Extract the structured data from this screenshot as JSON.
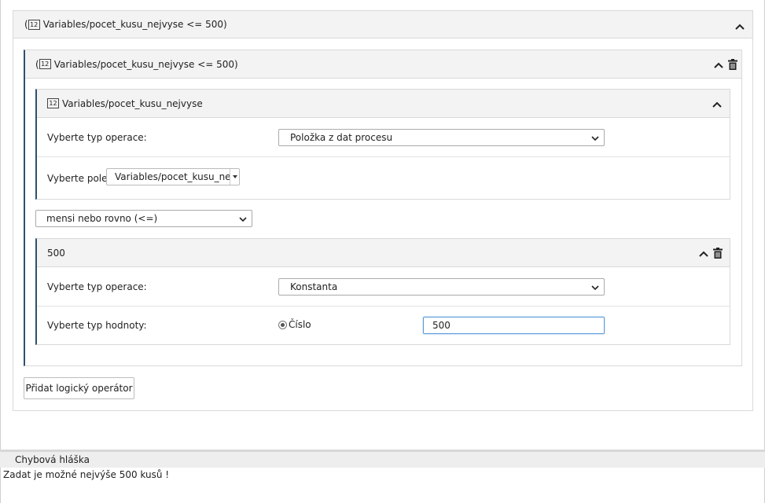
{
  "condition_outer": {
    "title": "Variables/pocet_kusu_nejvyse <= 500)",
    "prefix": "(",
    "icon": "number-12-icon",
    "icon_text": "12"
  },
  "condition_group": {
    "title": "Variables/pocet_kusu_nejvyse <= 500)",
    "prefix": "(",
    "icon": "number-12-icon",
    "icon_text": "12"
  },
  "left_operand": {
    "title": "Variables/pocet_kusu_nejvyse",
    "icon": "number-12-icon",
    "icon_text": "12",
    "operation_label": "Vyberte typ operace:",
    "operation_value": "Položka z dat procesu",
    "field_label": "Vyberte pole:",
    "field_value": "Variables/pocet_kusu_nej"
  },
  "operator": {
    "value": "mensi nebo rovno (<=)"
  },
  "right_operand": {
    "title": "500",
    "operation_label": "Vyberte typ operace:",
    "operation_value": "Konstanta",
    "value_type_label": "Vyberte typ hodnoty:",
    "radio_label": "Číslo",
    "radio_selected": true,
    "input_value": "500"
  },
  "actions": {
    "add_operator_label": "Přidat logický operátor"
  },
  "error_panel": {
    "title": "Chybová hláška",
    "message": "Zadat je možné nejvýše 500 kusů !"
  },
  "colors": {
    "accent": "#2f4f6f",
    "header_bg": "#f3f3f3",
    "input_focus": "#5b9bd5"
  }
}
